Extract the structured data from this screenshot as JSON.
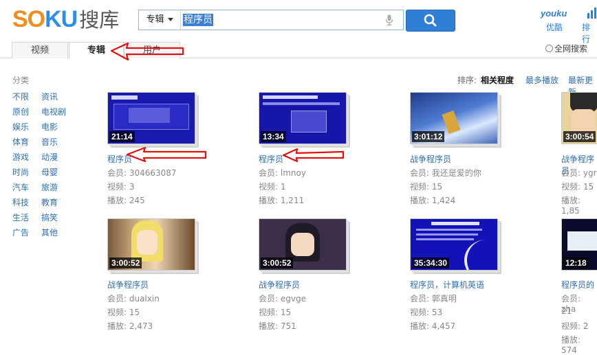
{
  "header": {
    "logo_so": "SO",
    "logo_ku": "KU",
    "logo_cn": "搜库",
    "search_type": "专辑",
    "search_query": "程序员",
    "youku_logo": "youku",
    "youku_label": "优酷",
    "rank_label": "排行"
  },
  "tabs": {
    "video": "视频",
    "album": "专辑",
    "user": "用户"
  },
  "web_search": "全网搜索",
  "sidebar": {
    "title": "分类",
    "items": [
      "不限",
      "资讯",
      "原创",
      "电视剧",
      "娱乐",
      "电影",
      "体育",
      "音乐",
      "游戏",
      "动漫",
      "时尚",
      "母婴",
      "汽车",
      "旅游",
      "科技",
      "教育",
      "生活",
      "搞笑",
      "广告",
      "其他"
    ]
  },
  "sort": {
    "label": "排序:",
    "relevance": "相关程度",
    "most_played": "最多播放",
    "newest": "最新更新"
  },
  "results": [
    {
      "title": "程序员",
      "member": "会员: 304663087",
      "videos": "视频: 3",
      "plays": "播放: 245",
      "duration": "21:14"
    },
    {
      "title": "程序员",
      "member": "会员: lmnoy",
      "videos": "视频: 1",
      "plays": "播放: 1,211",
      "duration": "13:34"
    },
    {
      "title": "战争程序员",
      "member": "会员: 我还是爱的你",
      "videos": "视频: 15",
      "plays": "播放: 1,424",
      "duration": "3:01:12"
    },
    {
      "title": "战争程序员",
      "member": "会员: ygr",
      "videos": "视频: 15",
      "plays": "播放: 1,85",
      "duration": "3:00:54"
    },
    {
      "title": "战争程序员",
      "member": "会员: dualxin",
      "videos": "视频: 15",
      "plays": "播放: 2,473",
      "duration": "3:00:52"
    },
    {
      "title": "战争程序员",
      "member": "会员: egvge",
      "videos": "视频: 15",
      "plays": "播放: 751",
      "duration": "3:00:52"
    },
    {
      "title": "程序员，计算机英语",
      "member": "会员: 郭真明",
      "videos": "视频: 53",
      "plays": "播放: 4,457",
      "duration": "35:34:30"
    },
    {
      "title": "程序员的",
      "member": "会员: zha",
      "videos_count_line": "21",
      "videos": "视频: 2",
      "plays": "播放: 574",
      "duration": "12:18"
    }
  ],
  "colors": {
    "link": "#2d6fb7",
    "search_button": "#2f7fd7",
    "annotation_arrow": "#e01010"
  }
}
